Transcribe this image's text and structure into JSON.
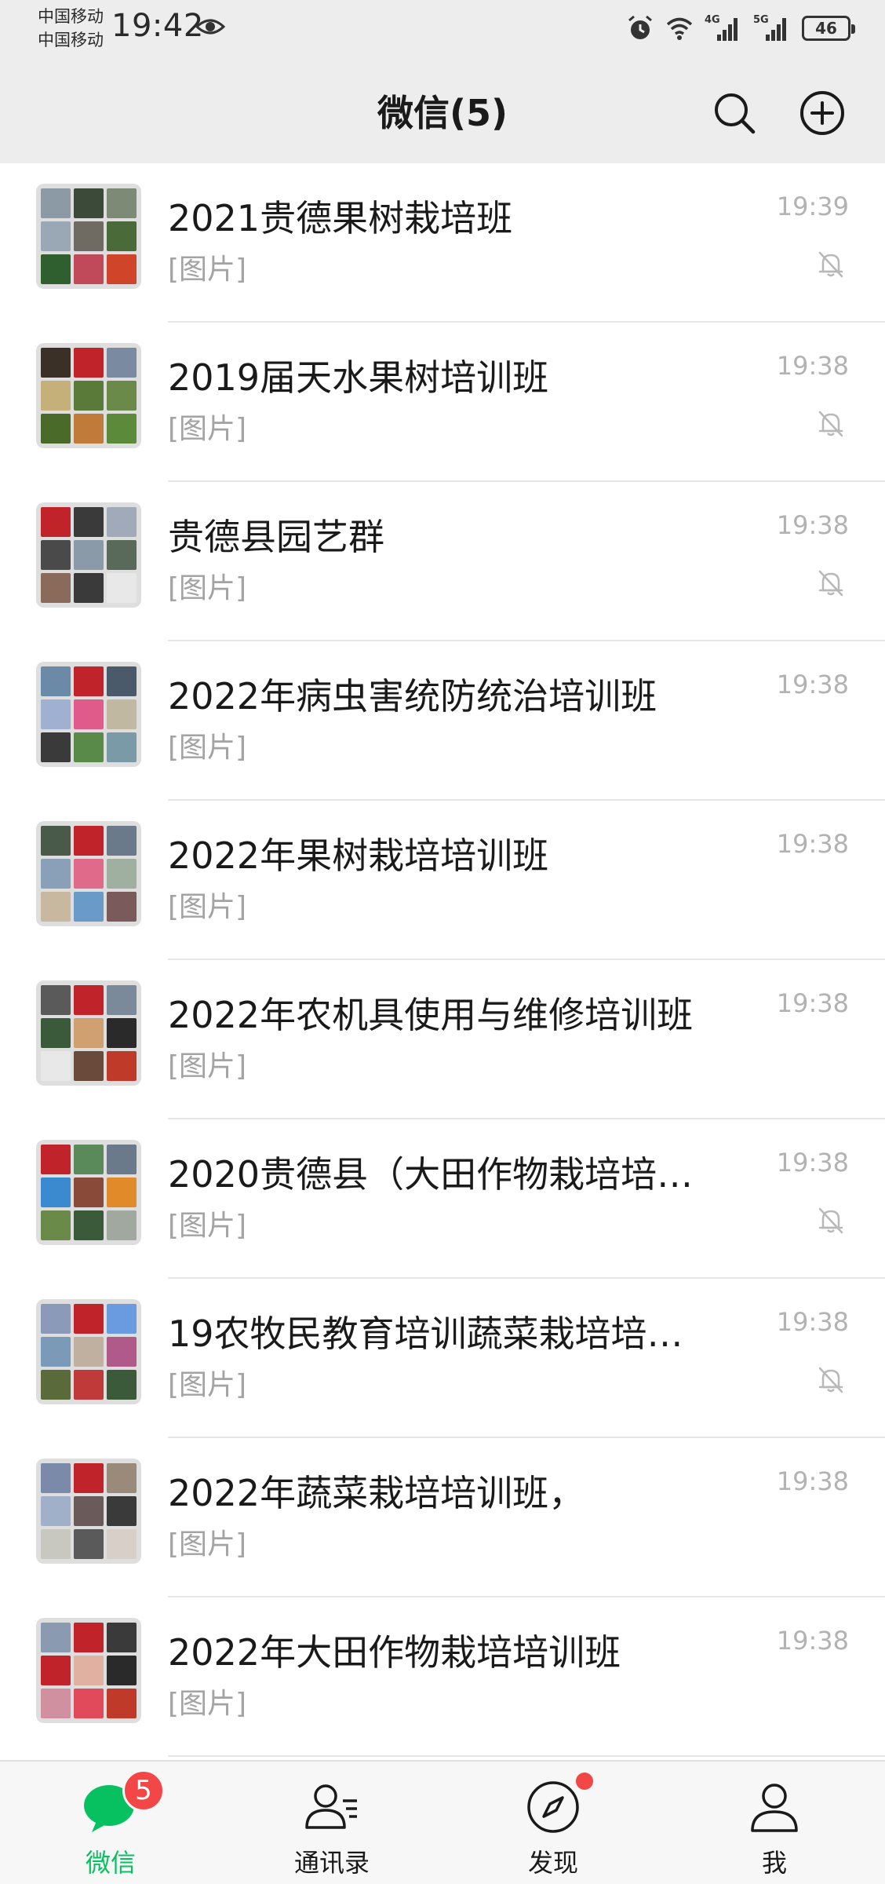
{
  "status_bar": {
    "carrier_1": "中国移动",
    "carrier_2": "中国移动",
    "time": "19:42",
    "net_1": "4G",
    "net_2": "5G",
    "battery": "46",
    "icons": [
      "eye-icon",
      "alarm-icon",
      "wifi-icon",
      "signal-icon",
      "signal-icon",
      "battery-icon"
    ]
  },
  "header": {
    "title": "微信(5)",
    "search_icon": "search-icon",
    "add_icon": "plus-circle-icon"
  },
  "chats": [
    {
      "name": "2021贵德果树栽培班",
      "preview": "[图片]",
      "time": "19:39",
      "muted": true,
      "colors": [
        "#8c9aa6",
        "#3c4a3a",
        "#7d8b76",
        "#9aa7b5",
        "#6f6a62",
        "#4a6a3a",
        "#2f5f2f",
        "#c04a5a",
        "#d0452a"
      ]
    },
    {
      "name": "2019届天水果树培训班",
      "preview": "[图片]",
      "time": "19:38",
      "muted": true,
      "colors": [
        "#3a3028",
        "#c0242a",
        "#7a8aa0",
        "#c6b07a",
        "#5a7a3a",
        "#6a8a4a",
        "#4a6a2a",
        "#c07a3a",
        "#5a8a3a"
      ]
    },
    {
      "name": "贵德县园艺群",
      "preview": "[图片]",
      "time": "19:38",
      "muted": true,
      "colors": [
        "#c0242a",
        "#3a3a3a",
        "#a0aab8",
        "#4a4a4a",
        "#8a9aa8",
        "#5a6a5a",
        "#8a6a5a",
        "#3a3a3a",
        "#e8e8e8"
      ]
    },
    {
      "name": "2022年病虫害统防统治培训班",
      "preview": "[图片]",
      "time": "19:38",
      "muted": false,
      "colors": [
        "#6a8aa8",
        "#c0242a",
        "#4a5a6a",
        "#a0b0d0",
        "#e05a8a",
        "#c0b8a0",
        "#3a3a3a",
        "#5a8a4a",
        "#7a9aa8"
      ]
    },
    {
      "name": "2022年果树栽培培训班",
      "preview": "[图片]",
      "time": "19:38",
      "muted": false,
      "colors": [
        "#4a5a4a",
        "#c0242a",
        "#6a7a8a",
        "#8aa0b8",
        "#e06a8a",
        "#a0b0a0",
        "#c8b8a0",
        "#6a9ac8",
        "#7a5a5a"
      ]
    },
    {
      "name": "2022年农机具使用与维修培训班",
      "preview": "[图片]",
      "time": "19:38",
      "muted": false,
      "colors": [
        "#5a5a5a",
        "#c0242a",
        "#7a8a9a",
        "#3a5a3a",
        "#d0a070",
        "#2a2a2a",
        "#e8e8e8",
        "#6a4a3a",
        "#c03a2a"
      ]
    },
    {
      "name": "2020贵德县（大田作物栽培培…",
      "preview": "[图片]",
      "time": "19:38",
      "muted": true,
      "colors": [
        "#c0242a",
        "#5a8a5a",
        "#6a7a8a",
        "#3a8ad0",
        "#8a4a3a",
        "#e08a2a",
        "#6a8a4a",
        "#3a5a3a",
        "#a0a8a0"
      ]
    },
    {
      "name": "19农牧民教育培训蔬菜栽培培…",
      "preview": "[图片]",
      "time": "19:38",
      "muted": true,
      "colors": [
        "#8a9ab8",
        "#c0242a",
        "#6a9ae0",
        "#7a9ab8",
        "#c0b0a0",
        "#b05a8a",
        "#5a6a3a",
        "#c03a3a",
        "#3a5a3a"
      ]
    },
    {
      "name": "2022年蔬菜栽培培训班，",
      "preview": "[图片]",
      "time": "19:38",
      "muted": false,
      "colors": [
        "#7a8aa8",
        "#c0242a",
        "#9a8a7a",
        "#a0b0c8",
        "#6a5a5a",
        "#3a3a3a",
        "#c8c8c0",
        "#5a5a5a",
        "#d8d0c8"
      ]
    },
    {
      "name": "2022年大田作物栽培培训班",
      "preview": "[图片]",
      "time": "19:38",
      "muted": false,
      "colors": [
        "#8a9ab0",
        "#c0242a",
        "#3a3a3a",
        "#c0242a",
        "#e0b0a0",
        "#2a2a2a",
        "#d090a0",
        "#e04a5a",
        "#c03a2a"
      ]
    }
  ],
  "tabs": [
    {
      "label": "微信",
      "icon": "chat-bubble-icon",
      "badge": "5",
      "active": true
    },
    {
      "label": "通讯录",
      "icon": "contacts-icon",
      "badge": "",
      "active": false
    },
    {
      "label": "发现",
      "icon": "compass-icon",
      "badge": "",
      "active": false,
      "dot": true
    },
    {
      "label": "我",
      "icon": "person-icon",
      "badge": "",
      "active": false
    }
  ],
  "colors": {
    "accent": "#07c160",
    "badge": "#f34646",
    "header_bg": "#ededed"
  }
}
